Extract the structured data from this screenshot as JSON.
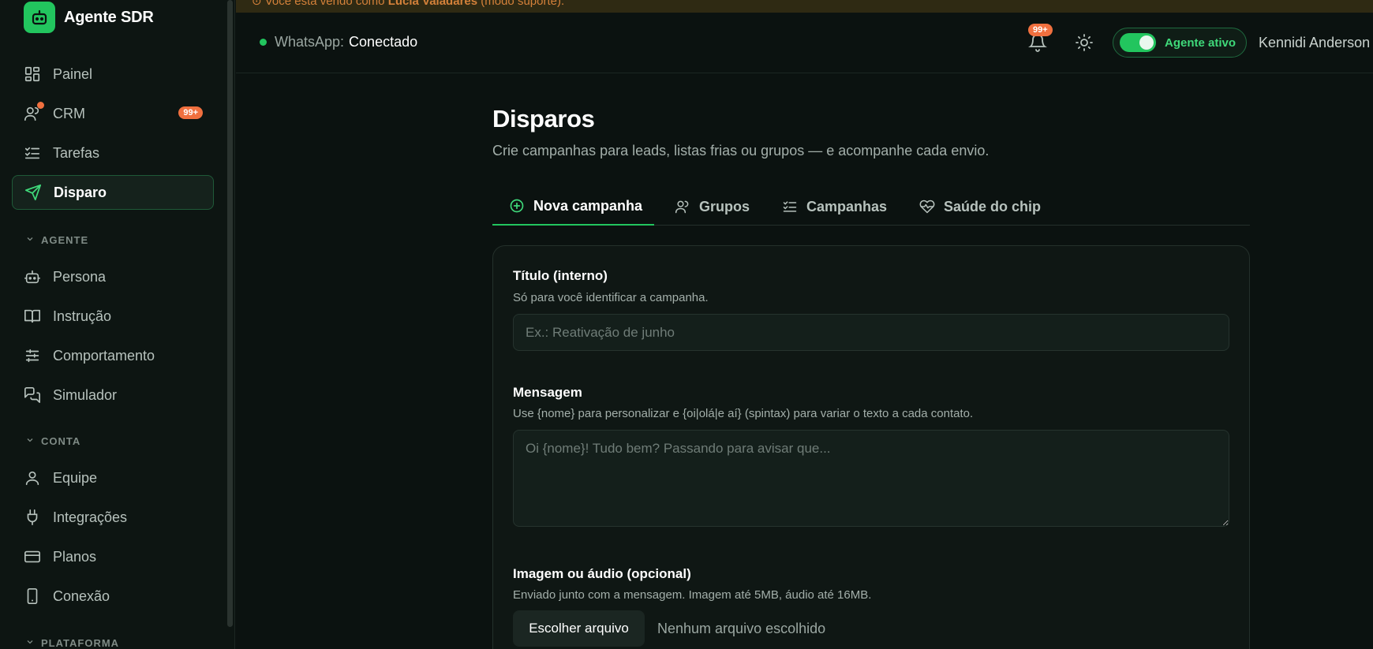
{
  "brand": {
    "name": "Agente SDR"
  },
  "sidebar": {
    "items": [
      {
        "label": "Painel",
        "icon": "dashboard-icon"
      },
      {
        "label": "CRM",
        "icon": "users-icon",
        "badge": "99+"
      },
      {
        "label": "Tarefas",
        "icon": "list-check-icon"
      },
      {
        "label": "Disparo",
        "icon": "send-icon",
        "active": true
      }
    ],
    "sections": [
      {
        "title": "AGENTE",
        "items": [
          {
            "label": "Persona",
            "icon": "bot-icon"
          },
          {
            "label": "Instrução",
            "icon": "book-icon"
          },
          {
            "label": "Comportamento",
            "icon": "sliders-icon"
          },
          {
            "label": "Simulador",
            "icon": "chat-icon"
          }
        ]
      },
      {
        "title": "CONTA",
        "items": [
          {
            "label": "Equipe",
            "icon": "user-icon"
          },
          {
            "label": "Integrações",
            "icon": "plug-icon"
          },
          {
            "label": "Planos",
            "icon": "credit-card-icon"
          },
          {
            "label": "Conexão",
            "icon": "smartphone-icon"
          }
        ]
      },
      {
        "title": "PLATAFORMA",
        "items": []
      }
    ]
  },
  "banner": {
    "prefix": "Você está vendo como ",
    "user": "Lucia Valadares",
    "suffix": " (modo suporte)."
  },
  "header": {
    "whatsapp_key": "WhatsApp:",
    "whatsapp_status": "Conectado",
    "notif_badge": "99+",
    "agent_label": "Agente ativo",
    "user_name": "Kennidi Anderson"
  },
  "main": {
    "title": "Disparos",
    "subtitle": "Crie campanhas para leads, listas frias ou grupos — e acompanhe cada envio.",
    "tabs": [
      {
        "label": "Nova campanha",
        "icon": "plus-circle-icon",
        "active": true
      },
      {
        "label": "Grupos",
        "icon": "users-icon"
      },
      {
        "label": "Campanhas",
        "icon": "list-check-icon"
      },
      {
        "label": "Saúde do chip",
        "icon": "heart-pulse-icon"
      }
    ],
    "form": {
      "title_label": "Título (interno)",
      "title_help": "Só para você identificar a campanha.",
      "title_placeholder": "Ex.: Reativação de junho",
      "message_label": "Mensagem",
      "message_help": "Use {nome} para personalizar e {oi|olá|e aí} (spintax) para variar o texto a cada contato.",
      "message_placeholder": "Oi {nome}! Tudo bem? Passando para avisar que...",
      "media_label": "Imagem ou áudio (opcional)",
      "media_help": "Enviado junto com a mensagem. Imagem até 5MB, áudio até 16MB.",
      "file_button": "Escolher arquivo",
      "file_none": "Nenhum arquivo escolhido"
    }
  },
  "colors": {
    "accent": "#22c55e",
    "badge": "#f0703f",
    "background": "#0b1210"
  }
}
